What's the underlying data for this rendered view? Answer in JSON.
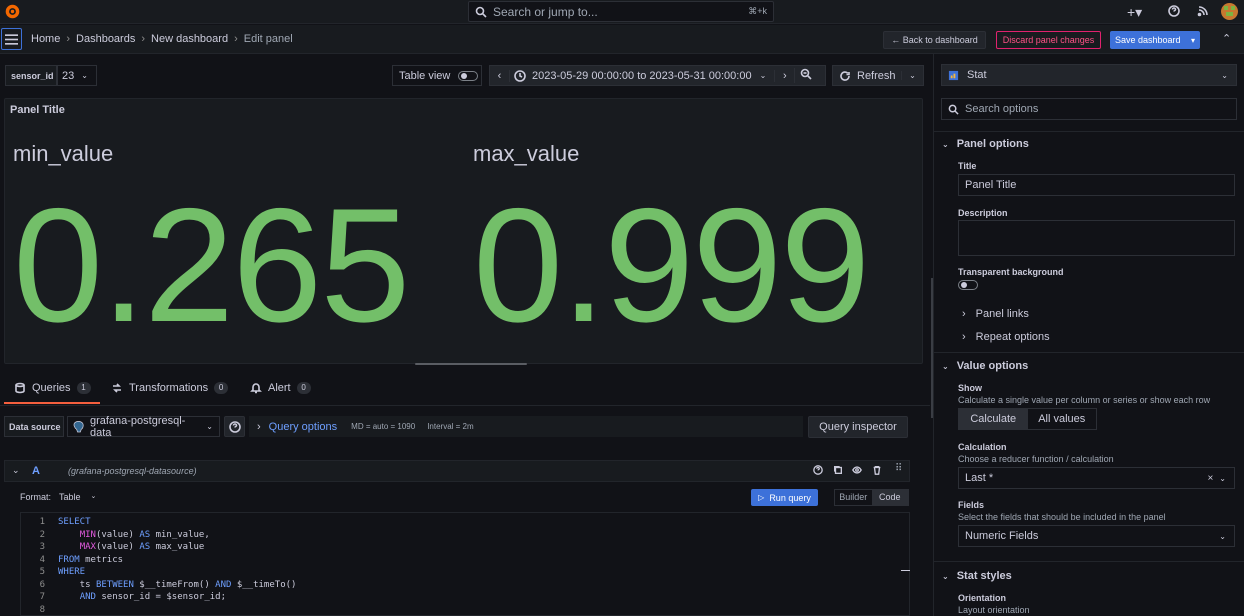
{
  "topbar": {
    "search_placeholder": "Search or jump to...",
    "search_shortcut": "⌘+k"
  },
  "breadcrumb": [
    "Home",
    "Dashboards",
    "New dashboard",
    "Edit panel"
  ],
  "header_buttons": {
    "back": "← Back to dashboard",
    "discard": "Discard panel changes",
    "save": "Save dashboard"
  },
  "variables": {
    "label": "sensor_id",
    "value": "23"
  },
  "toolbar": {
    "table_view": "Table view",
    "time_range": "2023-05-29 00:00:00 to 2023-05-31 00:00:00",
    "refresh": "Refresh"
  },
  "panel": {
    "title": "Panel Title",
    "stats": [
      {
        "label": "min_value",
        "value": "0.265"
      },
      {
        "label": "max_value",
        "value": "0.999"
      }
    ]
  },
  "tabs": [
    {
      "label": "Queries",
      "count": "1"
    },
    {
      "label": "Transformations",
      "count": "0"
    },
    {
      "label": "Alert",
      "count": "0"
    }
  ],
  "datasource": {
    "label": "Data source",
    "value": "grafana-postgresql-data",
    "query_options": "Query options",
    "md": "MD = auto = 1090",
    "interval": "Interval = 2m",
    "inspector": "Query inspector"
  },
  "query": {
    "ref": "A",
    "ds_name": "(grafana-postgresql-datasource)",
    "format_label": "Format:",
    "format_value": "Table",
    "run": "Run query",
    "mode_builder": "Builder",
    "mode_code": "Code",
    "lines": [
      {
        "n": "1",
        "parts": [
          {
            "t": "SELECT",
            "c": "kw"
          }
        ]
      },
      {
        "n": "2",
        "parts": [
          {
            "t": "    "
          },
          {
            "t": "MIN",
            "c": "fn"
          },
          {
            "t": "(value) "
          },
          {
            "t": "AS",
            "c": "kw"
          },
          {
            "t": " min_value,"
          }
        ]
      },
      {
        "n": "3",
        "parts": [
          {
            "t": "    "
          },
          {
            "t": "MAX",
            "c": "fn"
          },
          {
            "t": "(value) "
          },
          {
            "t": "AS",
            "c": "kw"
          },
          {
            "t": " max_value"
          }
        ]
      },
      {
        "n": "4",
        "parts": [
          {
            "t": "FROM",
            "c": "kw"
          },
          {
            "t": " metrics"
          }
        ]
      },
      {
        "n": "5",
        "parts": [
          {
            "t": "WHERE",
            "c": "kw"
          }
        ]
      },
      {
        "n": "6",
        "parts": [
          {
            "t": "    ts "
          },
          {
            "t": "BETWEEN",
            "c": "kw"
          },
          {
            "t": " $__timeFrom() "
          },
          {
            "t": "AND",
            "c": "kw"
          },
          {
            "t": " $__timeTo()"
          }
        ]
      },
      {
        "n": "7",
        "parts": [
          {
            "t": "    "
          },
          {
            "t": "AND",
            "c": "kw"
          },
          {
            "t": " sensor_id = $sensor_id;"
          }
        ]
      },
      {
        "n": "8",
        "parts": [
          {
            "t": ""
          }
        ]
      }
    ]
  },
  "options": {
    "viz": "Stat",
    "search_placeholder": "Search options",
    "panel_options": "Panel options",
    "title_label": "Title",
    "title_value": "Panel Title",
    "description_label": "Description",
    "transparent_label": "Transparent background",
    "panel_links": "Panel links",
    "repeat_options": "Repeat options",
    "value_options": "Value options",
    "show_label": "Show",
    "show_desc": "Calculate a single value per column or series or show each row",
    "calc_btn": "Calculate",
    "all_values_btn": "All values",
    "calculation_label": "Calculation",
    "calculation_desc": "Choose a reducer function / calculation",
    "calculation_value": "Last *",
    "fields_label": "Fields",
    "fields_desc": "Select the fields that should be included in the panel",
    "fields_value": "Numeric Fields",
    "stat_styles": "Stat styles",
    "orientation_label": "Orientation",
    "orientation_desc": "Layout orientation"
  }
}
